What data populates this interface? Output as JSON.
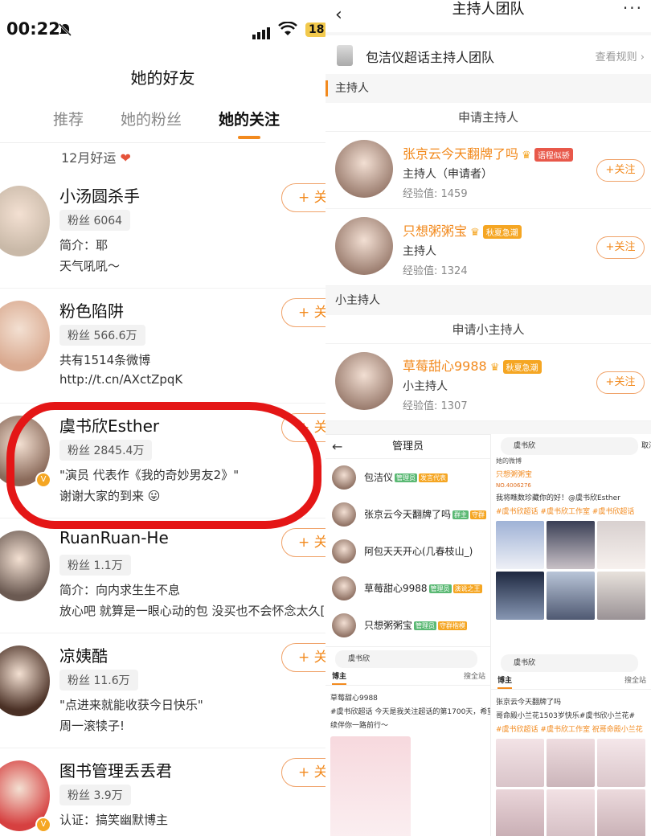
{
  "status_bar": {
    "time": "00:22",
    "battery": "18"
  },
  "left": {
    "title": "她的好友",
    "tabs": [
      "推荐",
      "她的粉丝",
      "她的关注"
    ],
    "group": "12月好运",
    "follow_label": "+ 关",
    "friends": [
      {
        "name": "小汤圆杀手",
        "fans": "粉丝 6064",
        "line1": "简介：耶",
        "line2": "天气吼吼～",
        "avatar": "#c9b9a8"
      },
      {
        "name": "粉色陷阱",
        "fans": "粉丝 566.6万",
        "line1": "共有1514条微博",
        "line2": "http://t.cn/AXctZpqK",
        "avatar": "#d9a98f"
      },
      {
        "name": "虞书欣Esther",
        "fans": "粉丝 2845.4万",
        "line1": "\"演员 代表作《我的奇妙男友2》\"",
        "line2": "谢谢大家的到来 😛",
        "avatar": "#8a6a5a"
      },
      {
        "name": "RuanRuan-He",
        "fans": "粉丝 1.1万",
        "line1": "简介：向内求生生不息",
        "line2": "放心吧 就算是一眼心动的包 没买也不会怀念太久[",
        "avatar": "#6b5a52"
      },
      {
        "name": "凉姨酷",
        "fans": "粉丝 11.6万",
        "line1": "\"点进来就能收获今日快乐\"",
        "line2": "周一滚犊子!",
        "avatar": "#4a3025"
      },
      {
        "name": "图书管理丢丢君",
        "fans": "粉丝 3.9万",
        "line1": "认证：搞笑幽默博主",
        "line2": "",
        "avatar": "#d64040"
      }
    ]
  },
  "right": {
    "title": "主持人团队",
    "team_name": "包洁仪超话主持人团队",
    "rules": "查看规则",
    "section_hosts": "主持人",
    "apply_host": "申请主持人",
    "section_small": "小主持人",
    "apply_small": "申请小主持人",
    "follow": "+关注",
    "hosts": [
      {
        "name": "张京云今天翻牌了吗",
        "role": "主持人（申请者）",
        "exp": "经验值: 1459",
        "tag": "语程似骄"
      },
      {
        "name": "只想粥粥宝",
        "role": "主持人",
        "exp": "经验值: 1324",
        "tag": "秋夏急潮"
      }
    ],
    "small_hosts": [
      {
        "name": "草莓甜心9988",
        "role": "小主持人",
        "exp": "经验值: 1307",
        "tag": "秋夏急潮"
      }
    ]
  },
  "admins": {
    "title": "管理员",
    "rows": [
      {
        "name": "包洁仪",
        "tag": "管理员",
        "tag2": "发言代表"
      },
      {
        "name": "张京云今天翻牌了吗",
        "tag": "群主",
        "tag2": "守群"
      },
      {
        "name": "阿包天天开心(几春枝山_)",
        "tag": "",
        "tag2": ""
      },
      {
        "name": "草莓甜心9988",
        "tag": "管理员",
        "tag2": "演说之王"
      },
      {
        "name": "只想粥粥宝",
        "tag": "管理员",
        "tag2": "守群楷模"
      }
    ]
  },
  "post1": {
    "search": "虞书欣",
    "cancel": "取消",
    "section": "她的微博",
    "author": "只想粥粥宝",
    "badge": "NO.4006276",
    "text": "我将瞧数珍藏你的好！@虞书欣Esther",
    "tags": "#虞书欣超话 #虞书欣工作室 #虞书欣超话"
  },
  "post2": {
    "search": "虞书欣",
    "tab": "博主",
    "tab2": "搜全站",
    "author": "草莓甜心9988",
    "text1": "#虞书欣超话 今天是我关注超话的第1700天，希望能继",
    "text2": "续伴你一路前行～"
  },
  "post3": {
    "search": "虞书欣",
    "tab": "博主",
    "tab2": "搜全站",
    "author": "张京云今天翻牌了吗",
    "text1": "哥命殿小兰花1503岁快乐#虞书欣小兰花#",
    "text2": "#虞书欣超话 #虞书欣工作室 祝哥命殿小兰花"
  }
}
